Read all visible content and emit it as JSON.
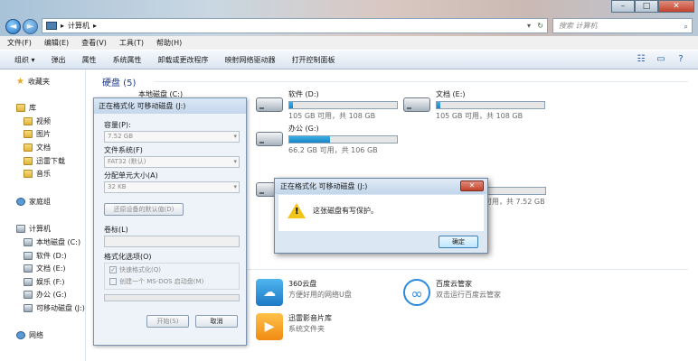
{
  "address": {
    "path": "计算机"
  },
  "search": {
    "placeholder": "搜索 计算机"
  },
  "menu": [
    "文件(F)",
    "编辑(E)",
    "查看(V)",
    "工具(T)",
    "帮助(H)"
  ],
  "toolbar": [
    "组织 ▾",
    "弹出",
    "属性",
    "系统属性",
    "卸载或更改程序",
    "映射网络驱动器",
    "打开控制面板"
  ],
  "sidebar": {
    "favorites": "收藏夹",
    "library": "库",
    "lib_items": [
      "视频",
      "图片",
      "文档",
      "迅雷下载",
      "音乐"
    ],
    "homegroup": "家庭组",
    "computer": "计算机",
    "drives": [
      "本地磁盘 (C:)",
      "软件 (D:)",
      "文档 (E:)",
      "娱乐 (F:)",
      "办公 (G:)",
      "可移动磁盘 (J:)"
    ],
    "network": "网络"
  },
  "content": {
    "section_title": "硬盘 (5)",
    "drives": [
      {
        "name": "本地磁盘 (C:)"
      },
      {
        "name": "软件 (D:)",
        "free": "105 GB 可用，共 108 GB",
        "used": 0.03
      },
      {
        "name": "文档 (E:)",
        "free": "105 GB 可用，共 108 GB",
        "used": 0.03
      },
      {
        "name": "办公 (G:)",
        "free": "66.2 GB 可用，共 106 GB",
        "used": 0.38
      }
    ],
    "removable_free": "可用，共 7.52 GB",
    "apps": [
      {
        "name": "360云盘",
        "desc": "方便好用的网络U盘"
      },
      {
        "name": "百度云管家",
        "desc": "双击运行百度云管家"
      },
      {
        "name": "迅雷影音片库",
        "desc": "系统文件夹"
      }
    ]
  },
  "format_dialog": {
    "title": "正在格式化 可移动磁盘 (J:)",
    "capacity_label": "容量(P):",
    "capacity_value": "7.52 GB",
    "fs_label": "文件系统(F)",
    "fs_value": "FAT32 (默认)",
    "alloc_label": "分配单元大小(A)",
    "alloc_value": "32 KB",
    "restore_button": "还原设备的默认值(D)",
    "volume_label": "卷标(L)",
    "options_label": "格式化选项(O)",
    "quick_format": "快速格式化(Q)",
    "msdos_disk": "创建一个 MS-DOS 启动盘(M)",
    "start_button": "开始(S)",
    "cancel_button": "取消"
  },
  "alert": {
    "title": "正在格式化 可移动磁盘 (J:)",
    "message": "这张磁盘有写保护。",
    "ok_button": "确定"
  }
}
